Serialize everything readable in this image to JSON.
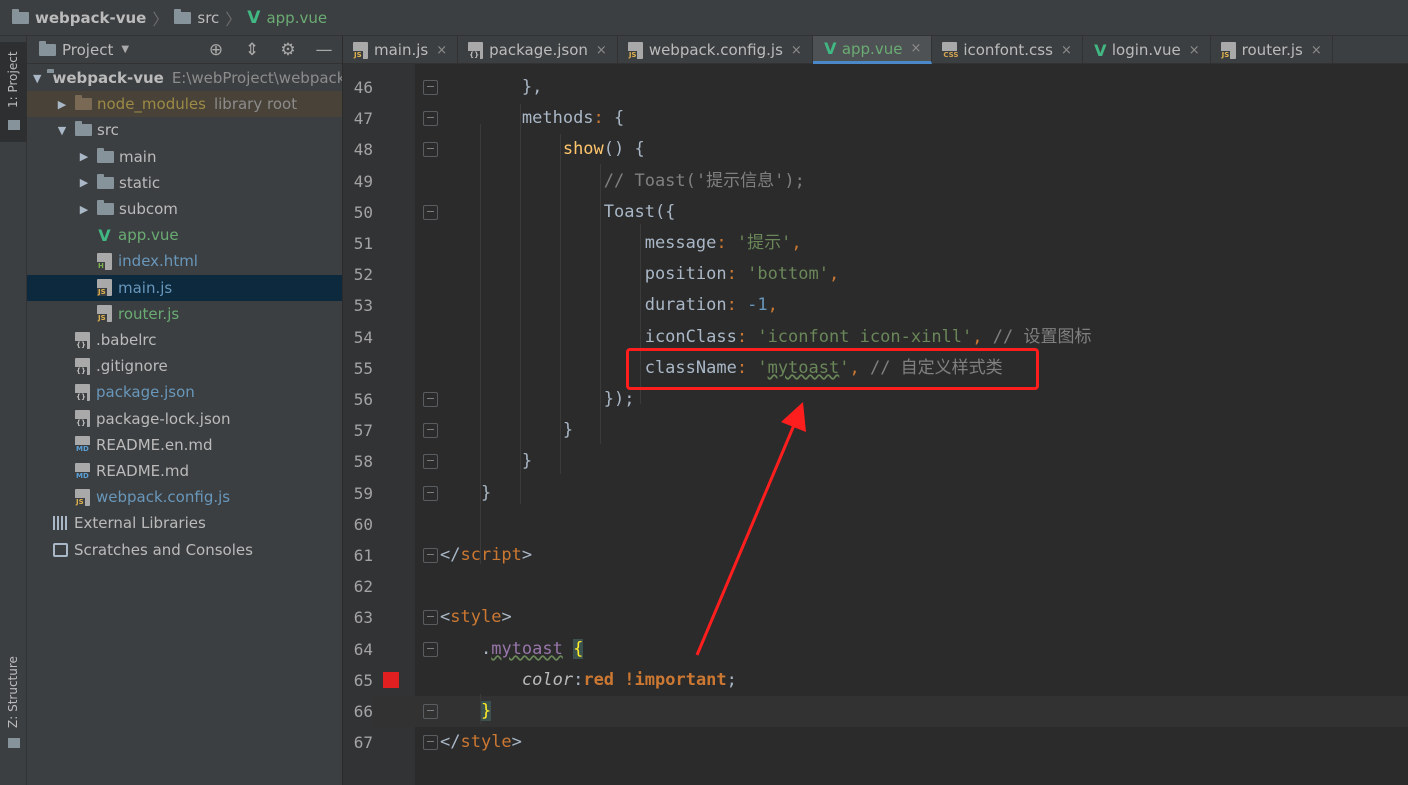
{
  "breadcrumb": {
    "project": "webpack-vue",
    "folder": "src",
    "file": "app.vue"
  },
  "left_strip": {
    "project_label": "1: Project",
    "structure_label": "Z: Structure"
  },
  "project_panel": {
    "title": "Project",
    "tree": [
      {
        "label": "webpack-vue",
        "hint": "E:\\webProject\\webpack-vue",
        "kind": "folder",
        "depth": 0,
        "expanded": true
      },
      {
        "label": "node_modules",
        "hint": "library root",
        "kind": "lib-folder",
        "depth": 1,
        "expanded": false
      },
      {
        "label": "src",
        "hint": "",
        "kind": "folder",
        "depth": 1,
        "expanded": true
      },
      {
        "label": "main",
        "hint": "",
        "kind": "folder",
        "depth": 2,
        "expanded": false
      },
      {
        "label": "static",
        "hint": "",
        "kind": "folder",
        "depth": 2,
        "expanded": false
      },
      {
        "label": "subcom",
        "hint": "",
        "kind": "folder",
        "depth": 2,
        "expanded": false
      },
      {
        "label": "app.vue",
        "hint": "",
        "kind": "vue",
        "depth": 2
      },
      {
        "label": "index.html",
        "hint": "",
        "kind": "html",
        "depth": 2
      },
      {
        "label": "main.js",
        "hint": "",
        "kind": "js",
        "depth": 2
      },
      {
        "label": "router.js",
        "hint": "",
        "kind": "js",
        "depth": 2
      },
      {
        "label": ".babelrc",
        "hint": "",
        "kind": "cfg",
        "depth": 1
      },
      {
        "label": ".gitignore",
        "hint": "",
        "kind": "cfg",
        "depth": 1
      },
      {
        "label": "package.json",
        "hint": "",
        "kind": "cfg",
        "depth": 1
      },
      {
        "label": "package-lock.json",
        "hint": "",
        "kind": "cfg",
        "depth": 1
      },
      {
        "label": "README.en.md",
        "hint": "",
        "kind": "md",
        "depth": 1
      },
      {
        "label": "README.md",
        "hint": "",
        "kind": "md",
        "depth": 1
      },
      {
        "label": "webpack.config.js",
        "hint": "",
        "kind": "js",
        "depth": 1
      },
      {
        "label": "External Libraries",
        "hint": "",
        "kind": "libs",
        "depth": 0
      },
      {
        "label": "Scratches and Consoles",
        "hint": "",
        "kind": "scratch",
        "depth": 0
      }
    ]
  },
  "tabs": [
    {
      "label": "main.js",
      "kind": "js"
    },
    {
      "label": "package.json",
      "kind": "cfg"
    },
    {
      "label": "webpack.config.js",
      "kind": "js"
    },
    {
      "label": "app.vue",
      "kind": "vue",
      "active": true
    },
    {
      "label": "iconfont.css",
      "kind": "css"
    },
    {
      "label": "login.vue",
      "kind": "vue"
    },
    {
      "label": "router.js",
      "kind": "js"
    }
  ],
  "icons": {
    "file_badge_js": "JS",
    "file_badge_html": "H",
    "file_badge_md": "MD",
    "file_badge_cfg": "{}",
    "file_badge_css": "CSS",
    "vue_glyph": "V",
    "close": "×"
  },
  "editor": {
    "lines": [
      {
        "n": "46",
        "tokens": [
          [
            "        ",
            "d"
          ],
          [
            "},",
            "d"
          ]
        ]
      },
      {
        "n": "47",
        "tokens": [
          [
            "        ",
            "d"
          ],
          [
            "methods",
            "d"
          ],
          [
            ":",
            "p"
          ],
          [
            " {",
            "d"
          ]
        ]
      },
      {
        "n": "48",
        "tokens": [
          [
            "            ",
            "d"
          ],
          [
            "show",
            "f"
          ],
          [
            "() {",
            "d"
          ]
        ]
      },
      {
        "n": "49",
        "tokens": [
          [
            "                ",
            "d"
          ],
          [
            "// Toast('提示信息');",
            "c"
          ]
        ]
      },
      {
        "n": "50",
        "tokens": [
          [
            "                ",
            "d"
          ],
          [
            "Toast({",
            "d"
          ]
        ]
      },
      {
        "n": "51",
        "tokens": [
          [
            "                    ",
            "d"
          ],
          [
            "message",
            "d"
          ],
          [
            ":",
            "p"
          ],
          [
            " ",
            "d"
          ],
          [
            "'提示'",
            "s"
          ],
          [
            ",",
            "p"
          ]
        ]
      },
      {
        "n": "52",
        "tokens": [
          [
            "                    ",
            "d"
          ],
          [
            "position",
            "d"
          ],
          [
            ":",
            "p"
          ],
          [
            " ",
            "d"
          ],
          [
            "'bottom'",
            "s"
          ],
          [
            ",",
            "p"
          ]
        ]
      },
      {
        "n": "53",
        "tokens": [
          [
            "                    ",
            "d"
          ],
          [
            "duration",
            "d"
          ],
          [
            ":",
            "p"
          ],
          [
            " ",
            "d"
          ],
          [
            "-1",
            "num"
          ],
          [
            ",",
            "p"
          ]
        ]
      },
      {
        "n": "54",
        "tokens": [
          [
            "                    ",
            "d"
          ],
          [
            "iconClass",
            "d"
          ],
          [
            ":",
            "p"
          ],
          [
            " ",
            "d"
          ],
          [
            "'iconfont icon-xinll'",
            "s"
          ],
          [
            ",",
            "p"
          ],
          [
            " // 设置图标",
            "c"
          ]
        ]
      },
      {
        "n": "55",
        "tokens": [
          [
            "                    ",
            "d"
          ],
          [
            "className",
            "d"
          ],
          [
            ":",
            "p"
          ],
          [
            " ",
            "d"
          ],
          [
            "'",
            "s"
          ],
          [
            "mytoast",
            "su"
          ],
          [
            "'",
            "s"
          ],
          [
            ",",
            "p"
          ],
          [
            " // 自定义样式类",
            "c"
          ]
        ]
      },
      {
        "n": "56",
        "tokens": [
          [
            "                ",
            "d"
          ],
          [
            "});",
            "d"
          ]
        ]
      },
      {
        "n": "57",
        "tokens": [
          [
            "            ",
            "d"
          ],
          [
            "}",
            "d"
          ]
        ]
      },
      {
        "n": "58",
        "tokens": [
          [
            "        ",
            "d"
          ],
          [
            "}",
            "d"
          ]
        ]
      },
      {
        "n": "59",
        "tokens": [
          [
            "    ",
            "d"
          ],
          [
            "}",
            "d"
          ]
        ]
      },
      {
        "n": "60",
        "tokens": []
      },
      {
        "n": "61",
        "tokens": [
          [
            "</",
            "d"
          ],
          [
            "script",
            "t"
          ],
          [
            ">",
            "d"
          ]
        ]
      },
      {
        "n": "62",
        "tokens": []
      },
      {
        "n": "63",
        "tokens": [
          [
            "<",
            "d"
          ],
          [
            "style",
            "t"
          ],
          [
            ">",
            "d"
          ]
        ]
      },
      {
        "n": "64",
        "tokens": [
          [
            "    ",
            "d"
          ],
          [
            ".",
            "d"
          ],
          [
            "mytoast",
            "sel"
          ],
          [
            " ",
            "d"
          ],
          [
            "{",
            "bh"
          ]
        ]
      },
      {
        "n": "65",
        "tokens": [
          [
            "        ",
            "d"
          ],
          [
            "color",
            "pi"
          ],
          [
            ":",
            "d"
          ],
          [
            "red",
            "kw"
          ],
          [
            " ",
            "d"
          ],
          [
            "!important",
            "imp"
          ],
          [
            ";",
            "d"
          ]
        ]
      },
      {
        "n": "66",
        "tokens": [
          [
            "    ",
            "d"
          ],
          [
            "}",
            "bh"
          ]
        ]
      },
      {
        "n": "67",
        "tokens": [
          [
            "</",
            "d"
          ],
          [
            "style",
            "t"
          ],
          [
            ">",
            "d"
          ]
        ]
      }
    ],
    "current_line": "66",
    "breakpoint_line": "65"
  }
}
